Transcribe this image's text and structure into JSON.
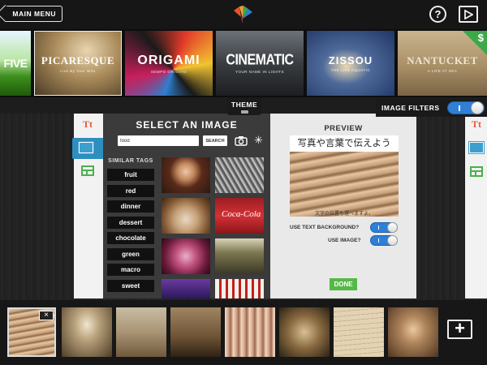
{
  "topbar": {
    "main_menu_label": "MAIN MENU",
    "help_label": "?",
    "logo_icon": "origami-crane-icon",
    "play_icon": "play-icon"
  },
  "themes": [
    {
      "title": "FIVE",
      "subtitle": ""
    },
    {
      "title": "PICARESQUE",
      "subtitle": "Live By Your Wits"
    },
    {
      "title": "ORIGAMI",
      "subtitle": "SEMPO ORIGATO"
    },
    {
      "title": "CINEMATIC",
      "subtitle": "YOUR NAME IN LIGHTS"
    },
    {
      "title": "ZISSOU",
      "subtitle": "THE LIFE AQUATIC"
    },
    {
      "title": "NANTUCKET",
      "subtitle": "A LIFE AT SEA"
    }
  ],
  "premium_badge": "$",
  "theme_tab_label": "THEME",
  "image_filters": {
    "label": "IMAGE FILTERS",
    "on": true
  },
  "select_image": {
    "title": "SELECT AN IMAGE",
    "search_value": "food",
    "search_button": "SEARCH",
    "similar_tags_title": "SIMILAR TAGS",
    "tags": [
      "fruit",
      "red",
      "dinner",
      "dessert",
      "chocolate",
      "green",
      "macro",
      "sweet"
    ],
    "thumb_coca_text": "Coca-Cola"
  },
  "preview": {
    "title": "PREVIEW",
    "caption": "写真や言葉で伝えよう",
    "subcaption": "文字の位置も選べますよ。",
    "use_text_background_label": "USE TEXT BACKGROUND?",
    "use_text_background": true,
    "use_image_label": "USE IMAGE?",
    "use_image": true,
    "done_label": "DONE"
  },
  "filmstrip": {
    "close_label": "×",
    "add_label": "+"
  },
  "colors": {
    "accent_blue": "#2f7fd6",
    "done_green": "#56b848",
    "tool_red": "#e45a3b",
    "badge_green": "#3ca84a"
  }
}
